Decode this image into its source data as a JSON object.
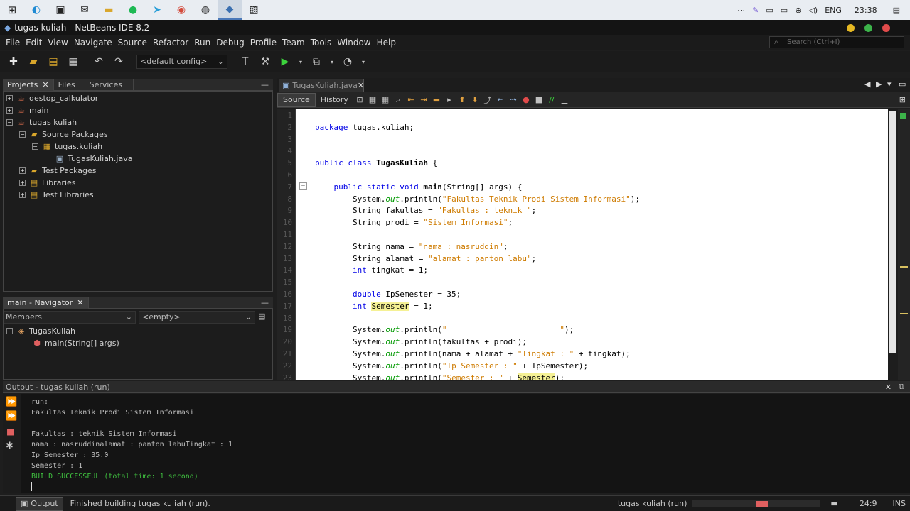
{
  "taskbar": {
    "apps": [
      "windows-icon",
      "edge-icon",
      "store-icon",
      "mail-icon",
      "folder-icon",
      "spotify-icon",
      "telegram-icon",
      "chrome-icon",
      "obs-icon",
      "netbeans-icon",
      "photos-icon"
    ],
    "lang": "ENG",
    "time": "23:38"
  },
  "window": {
    "title": "tugas kuliah - NetBeans IDE 8.2"
  },
  "menu": [
    "File",
    "Edit",
    "View",
    "Navigate",
    "Source",
    "Refactor",
    "Run",
    "Debug",
    "Profile",
    "Team",
    "Tools",
    "Window",
    "Help"
  ],
  "search": {
    "placeholder": "Search (Ctrl+I)"
  },
  "toolbar": {
    "config": "<default config>"
  },
  "projects": {
    "tabs": [
      "Projects",
      "Files",
      "Services"
    ],
    "tree": [
      {
        "label": "destop_calkulator",
        "depth": 0,
        "toggle": "+",
        "icon": "project-icon"
      },
      {
        "label": "main",
        "depth": 0,
        "toggle": "+",
        "icon": "project-icon"
      },
      {
        "label": "tugas kuliah",
        "depth": 0,
        "toggle": "-",
        "icon": "project-icon"
      },
      {
        "label": "Source Packages",
        "depth": 1,
        "toggle": "-",
        "icon": "package-folder-icon"
      },
      {
        "label": "tugas.kuliah",
        "depth": 2,
        "toggle": "-",
        "icon": "package-icon"
      },
      {
        "label": "TugasKuliah.java",
        "depth": 3,
        "toggle": "",
        "icon": "java-file-icon"
      },
      {
        "label": "Test Packages",
        "depth": 1,
        "toggle": "+",
        "icon": "package-folder-icon"
      },
      {
        "label": "Libraries",
        "depth": 1,
        "toggle": "+",
        "icon": "library-icon"
      },
      {
        "label": "Test Libraries",
        "depth": 1,
        "toggle": "+",
        "icon": "library-icon"
      }
    ]
  },
  "navigator": {
    "tab": "main - Navigator",
    "filter": "Members",
    "empty": "<empty>",
    "tree": [
      {
        "label": "TugasKuliah",
        "depth": 0
      },
      {
        "label": "main(String[] args)",
        "depth": 1
      }
    ]
  },
  "editor": {
    "tab": "TugasKuliah.java",
    "source_tab": "Source",
    "history_tab": "History",
    "lines": [
      [],
      [
        {
          "t": "package ",
          "c": "kw"
        },
        {
          "t": "tugas.kuliah;"
        }
      ],
      [],
      [],
      [
        {
          "t": "public class ",
          "c": "kw"
        },
        {
          "t": "TugasKuliah",
          "c": "bold"
        },
        {
          "t": " {"
        }
      ],
      [],
      [
        {
          "t": "    public static void ",
          "c": "kw"
        },
        {
          "t": "main",
          "c": "bold"
        },
        {
          "t": "(String[] args) {"
        }
      ],
      [
        {
          "t": "        System."
        },
        {
          "t": "out",
          "c": "fld"
        },
        {
          "t": ".println("
        },
        {
          "t": "\"Fakultas Teknik Prodi Sistem Informasi\"",
          "c": "str"
        },
        {
          "t": ");"
        }
      ],
      [
        {
          "t": "        String fakultas = "
        },
        {
          "t": "\"Fakultas : teknik \"",
          "c": "str"
        },
        {
          "t": ";"
        }
      ],
      [
        {
          "t": "        String prodi = "
        },
        {
          "t": "\"Sistem Informasi\"",
          "c": "str"
        },
        {
          "t": ";"
        }
      ],
      [],
      [
        {
          "t": "        String nama = "
        },
        {
          "t": "\"nama : nasruddin\"",
          "c": "str"
        },
        {
          "t": ";"
        }
      ],
      [
        {
          "t": "        String alamat = "
        },
        {
          "t": "\"alamat : panton labu\"",
          "c": "str"
        },
        {
          "t": ";"
        }
      ],
      [
        {
          "t": "        int ",
          "c": "kw"
        },
        {
          "t": "tingkat = 1;"
        }
      ],
      [],
      [
        {
          "t": "        double ",
          "c": "kw"
        },
        {
          "t": "IpSemester = 35;"
        }
      ],
      [
        {
          "t": "        int ",
          "c": "kw"
        },
        {
          "t": "Semester",
          "c": "hl"
        },
        {
          "t": " = 1;"
        }
      ],
      [],
      [
        {
          "t": "        System."
        },
        {
          "t": "out",
          "c": "fld"
        },
        {
          "t": ".println("
        },
        {
          "t": "\"________________________\"",
          "c": "str"
        },
        {
          "t": ");"
        }
      ],
      [
        {
          "t": "        System."
        },
        {
          "t": "out",
          "c": "fld"
        },
        {
          "t": ".println(fakultas + prodi);"
        }
      ],
      [
        {
          "t": "        System."
        },
        {
          "t": "out",
          "c": "fld"
        },
        {
          "t": ".println(nama + alamat + "
        },
        {
          "t": "\"Tingkat : \"",
          "c": "str"
        },
        {
          "t": " + tingkat);"
        }
      ],
      [
        {
          "t": "        System."
        },
        {
          "t": "out",
          "c": "fld"
        },
        {
          "t": ".println("
        },
        {
          "t": "\"Ip Semester : \"",
          "c": "str"
        },
        {
          "t": " + IpSemester);"
        }
      ],
      [
        {
          "t": "        System."
        },
        {
          "t": "out",
          "c": "fld"
        },
        {
          "t": ".println("
        },
        {
          "t": "\"Semester : \"",
          "c": "str"
        },
        {
          "t": " + "
        },
        {
          "t": "Semester",
          "c": "hl"
        },
        {
          "t": ");"
        }
      ]
    ]
  },
  "output": {
    "title": "Output - tugas kuliah (run)",
    "lines": [
      {
        "t": "run:",
        "c": ""
      },
      {
        "t": "Fakultas Teknik Prodi Sistem Informasi",
        "c": ""
      },
      {
        "t": "________________________",
        "c": ""
      },
      {
        "t": "Fakultas : teknik Sistem Informasi",
        "c": ""
      },
      {
        "t": "nama : nasruddinalamat : panton labuTingkat : 1",
        "c": ""
      },
      {
        "t": "Ip Semester : 35.0",
        "c": ""
      },
      {
        "t": "Semester : 1",
        "c": ""
      },
      {
        "t": "BUILD SUCCESSFUL (total time: 1 second)",
        "c": "success"
      }
    ]
  },
  "status": {
    "output_tab": "Output",
    "message": "Finished building tugas kuliah (run).",
    "project": "tugas kuliah (run)",
    "position": "24:9",
    "mode": "INS"
  },
  "colors": {
    "success": "#3fbf3f",
    "run": "#3cd33c",
    "accent_red": "#e14b4b"
  }
}
